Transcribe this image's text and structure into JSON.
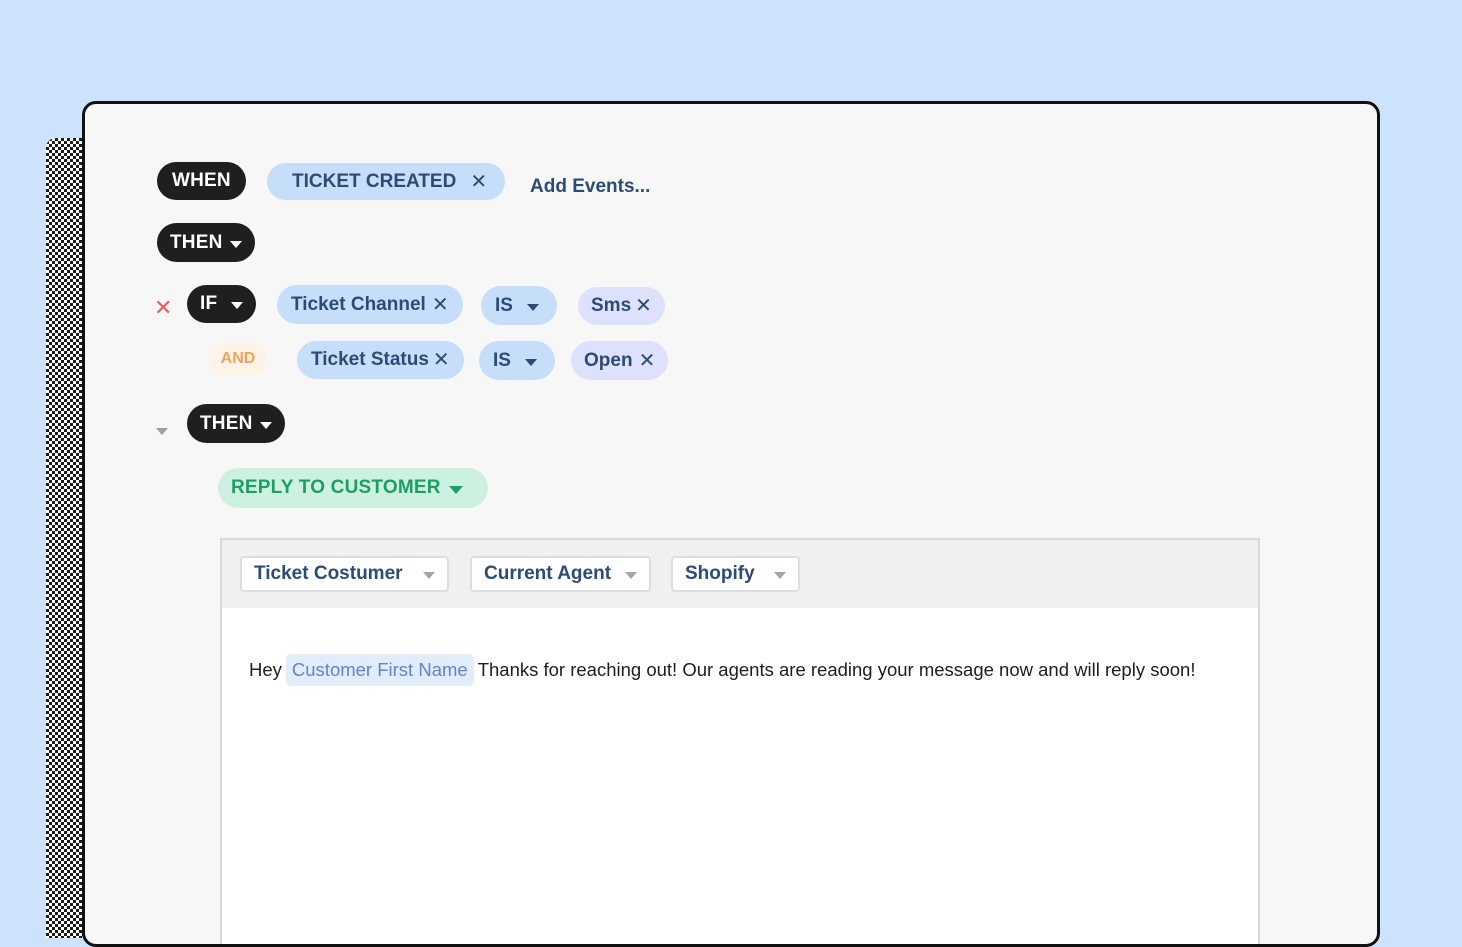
{
  "trigger": {
    "when_label": "WHEN",
    "event_label": "TICKET CREATED",
    "add_events_label": "Add Events..."
  },
  "then_primary": {
    "label": "THEN"
  },
  "conditions": {
    "if_label": "IF",
    "and_label": "AND",
    "rows": [
      {
        "field": "Ticket Channel",
        "operator": "IS",
        "value": "Sms"
      },
      {
        "field": "Ticket Status",
        "operator": "IS",
        "value": "Open"
      }
    ]
  },
  "then_secondary": {
    "label": "THEN"
  },
  "action": {
    "label": "REPLY TO CUSTOMER"
  },
  "editor": {
    "toolbar": [
      "Ticket Costumer",
      "Current Agent",
      "Shopify"
    ],
    "message_prefix": "Hey",
    "variable_label": "Customer First Name",
    "message_suffix": "Thanks for reaching out! Our agents are reading your message now and will reply soon!"
  },
  "icons": {
    "close": "close-icon",
    "caret": "caret-down-icon"
  },
  "colors": {
    "background": "#cde3fd",
    "dark_pill": "#1f1f1f",
    "blue_pill": "#c6defa",
    "purple_pill": "#dde1fb",
    "green_pill": "#cdf1e0",
    "and_badge": "#fdf3e7",
    "remove_icon": "#e0615d"
  }
}
